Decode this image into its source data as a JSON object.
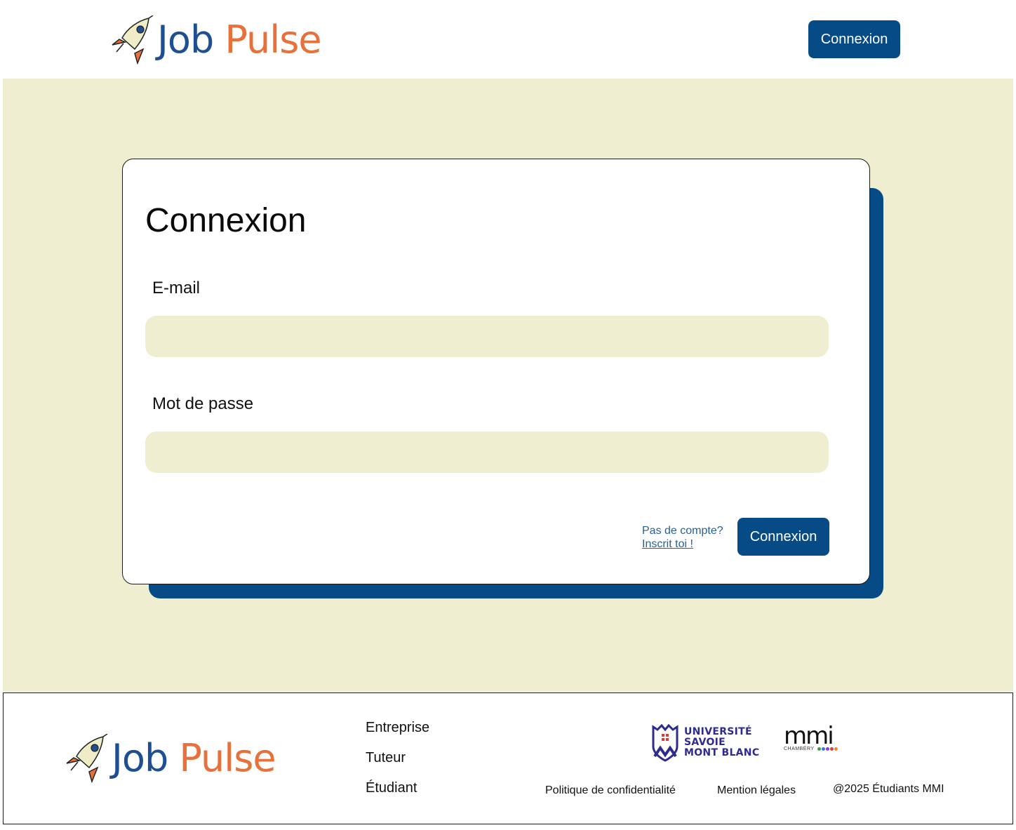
{
  "colors": {
    "primary": "#064b86",
    "background": "#efeed1",
    "brand_blue": "#1f4f93",
    "brand_orange": "#e8703a",
    "link": "#2a5f96"
  },
  "header": {
    "brand_job": "Job",
    "brand_pulse": "Pulse",
    "login_button": "Connexion"
  },
  "login_card": {
    "title": "Connexion",
    "email_label": "E-mail",
    "email_value": "",
    "password_label": "Mot de passe",
    "password_value": "",
    "no_account_text": "Pas de compte?",
    "signup_link": "Inscrit toi !",
    "submit_button": "Connexion"
  },
  "footer": {
    "brand_job": "Job",
    "brand_pulse": "Pulse",
    "nav": [
      "Entreprise",
      "Tuteur",
      "Étudiant"
    ],
    "partner_usmb": [
      "UNIVERSITÉ",
      "SAVOIE",
      "MONT BLANC"
    ],
    "partner_mmi": "mmi",
    "partner_mmi_city": "CHAMBÉRY",
    "privacy_link": "Politique de confidentialité",
    "legal_link": "Mention légales",
    "copyright": "@2025 Étudiants MMI"
  }
}
